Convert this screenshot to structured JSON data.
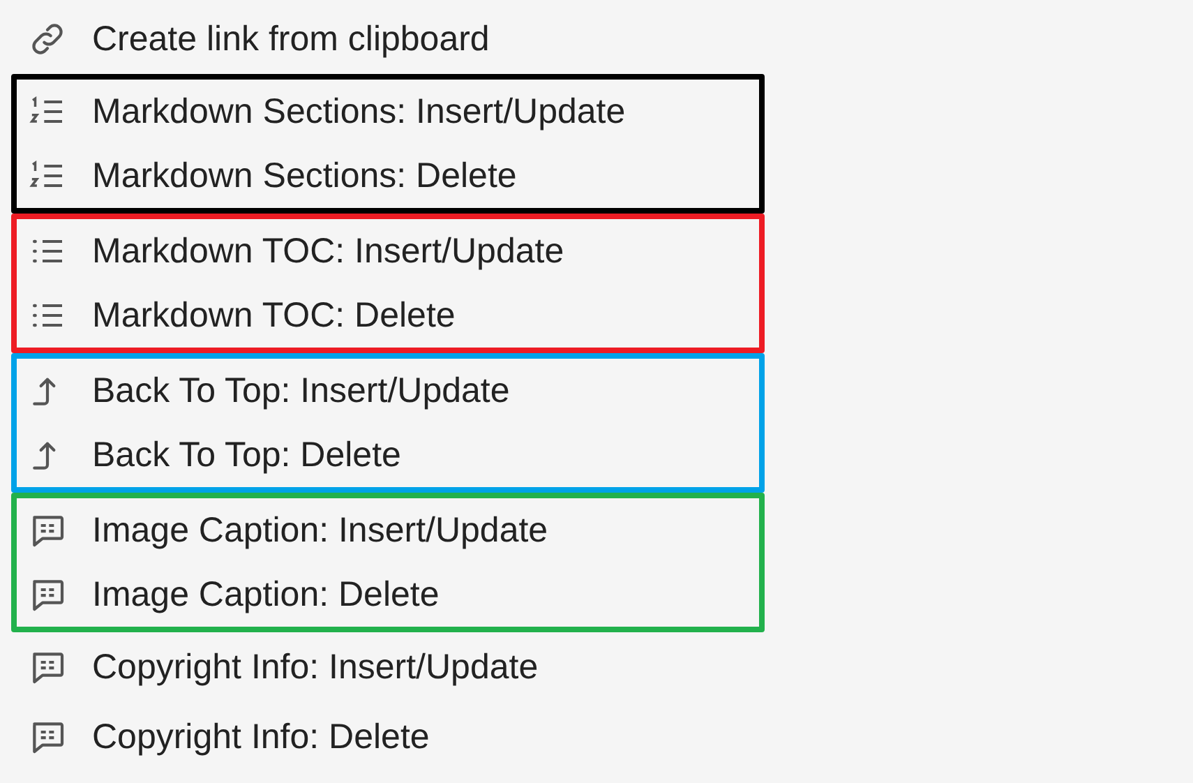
{
  "sections": [
    {
      "items": [
        {
          "kind": "link",
          "label": "Create link from clipboard"
        }
      ]
    },
    {
      "color": "#000000",
      "items": [
        {
          "kind": "numbered",
          "label": "Markdown Sections: Insert/Update"
        },
        {
          "kind": "numbered",
          "label": "Markdown Sections: Delete"
        }
      ]
    },
    {
      "color": "#ed1c24",
      "items": [
        {
          "kind": "list",
          "label": "Markdown TOC: Insert/Update"
        },
        {
          "kind": "list",
          "label": "Markdown TOC: Delete"
        }
      ]
    },
    {
      "color": "#00a2e8",
      "items": [
        {
          "kind": "arrow",
          "label": "Back To Top: Insert/Update"
        },
        {
          "kind": "arrow",
          "label": "Back To Top: Delete"
        }
      ]
    },
    {
      "color": "#22b14c",
      "items": [
        {
          "kind": "message",
          "label": "Image Caption: Insert/Update"
        },
        {
          "kind": "message",
          "label": "Image Caption: Delete"
        }
      ]
    },
    {
      "items": [
        {
          "kind": "message",
          "label": "Copyright Info: Insert/Update"
        },
        {
          "kind": "message",
          "label": "Copyright Info: Delete"
        }
      ]
    }
  ]
}
